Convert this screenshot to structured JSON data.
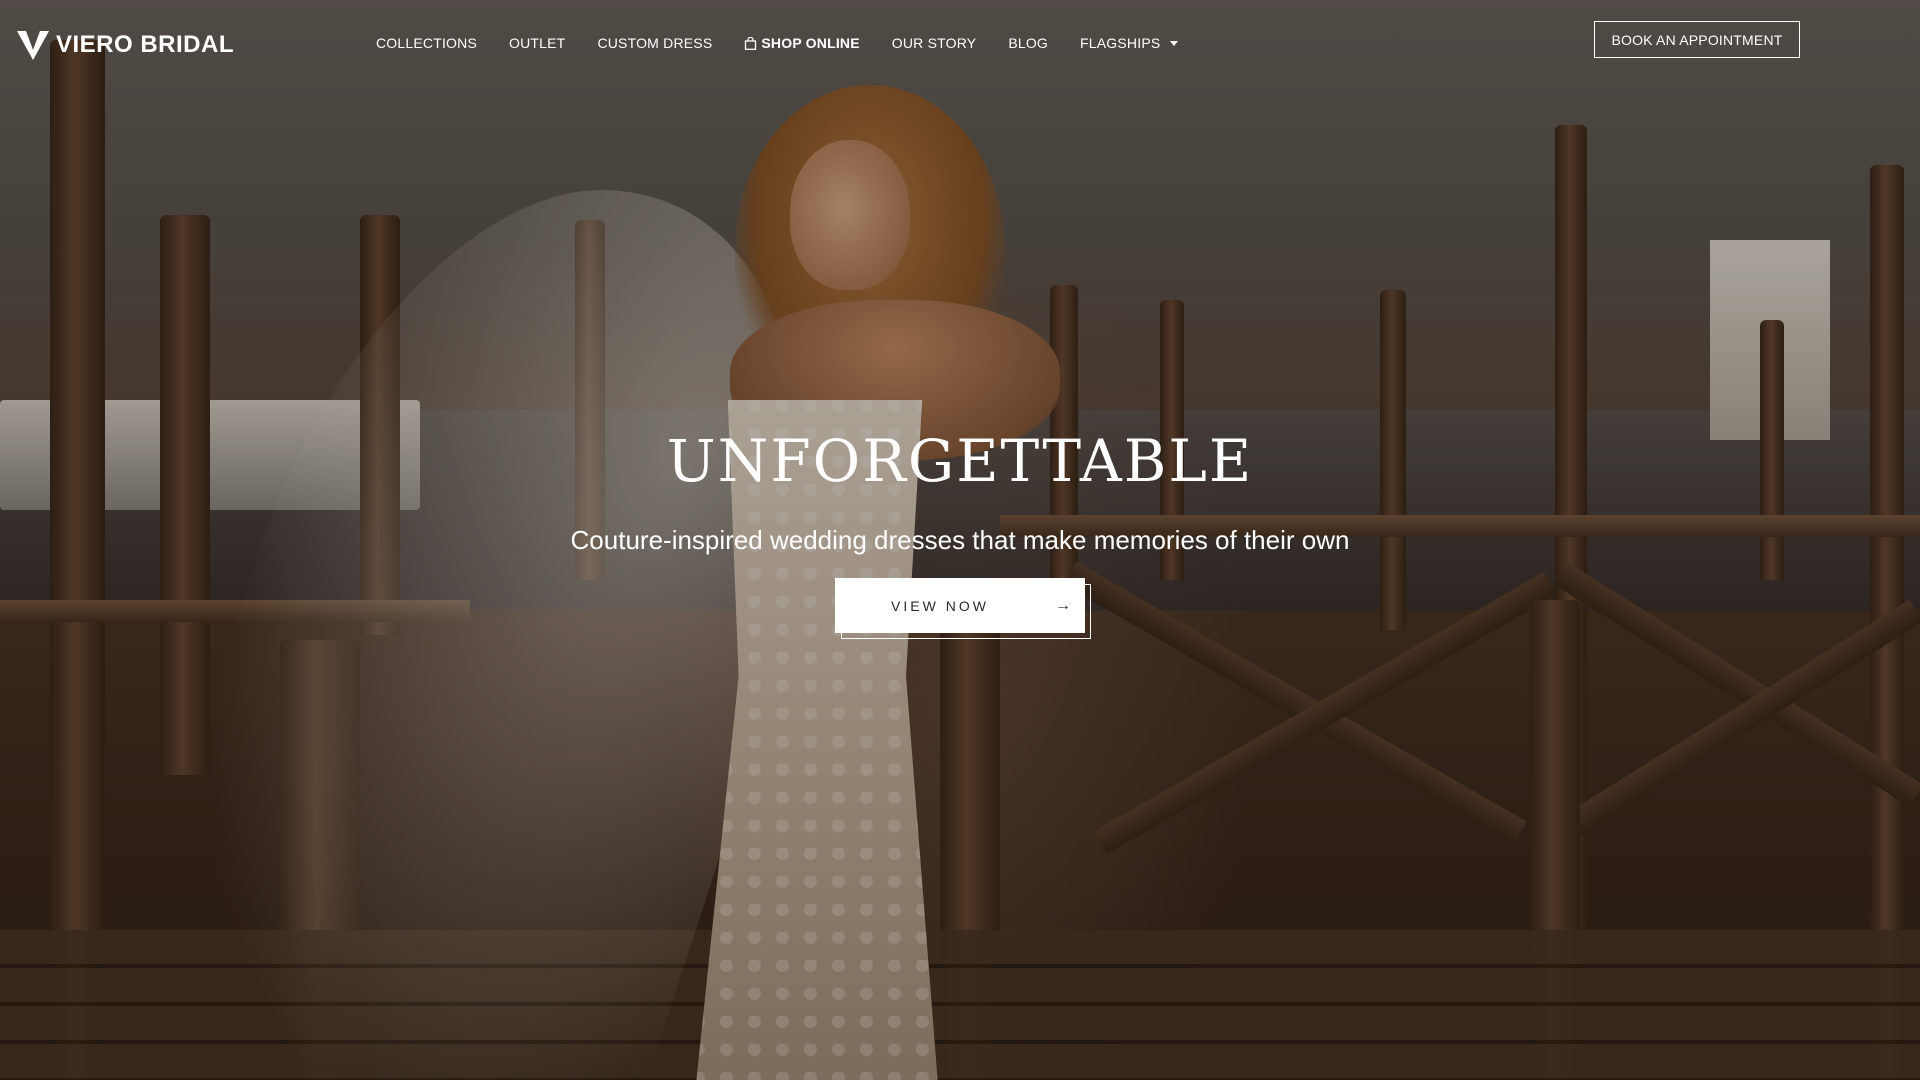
{
  "brand": {
    "name": "VIERO BRIDAL",
    "logo_icon": "v-logo-icon"
  },
  "nav": {
    "items": [
      {
        "label": "COLLECTIONS"
      },
      {
        "label": "OUTLET"
      },
      {
        "label": "CUSTOM DRESS"
      },
      {
        "label": "SHOP ONLINE",
        "icon": "shopping-bag-icon"
      },
      {
        "label": "OUR STORY"
      },
      {
        "label": "BLOG"
      },
      {
        "label": "FLAGSHIPS",
        "icon": "caret-down-icon"
      }
    ]
  },
  "header": {
    "appointment_label": "BOOK AN APPOINTMENT"
  },
  "hero": {
    "title": "UNFORGETTABLE",
    "subtitle": "Couture-inspired wedding dresses that make memories of their own",
    "cta_label": "VIEW NOW",
    "cta_icon": "arrow-right-icon"
  },
  "colors": {
    "text": "#ffffff",
    "button_bg": "#ffffff",
    "button_text": "#2a2a2a"
  }
}
